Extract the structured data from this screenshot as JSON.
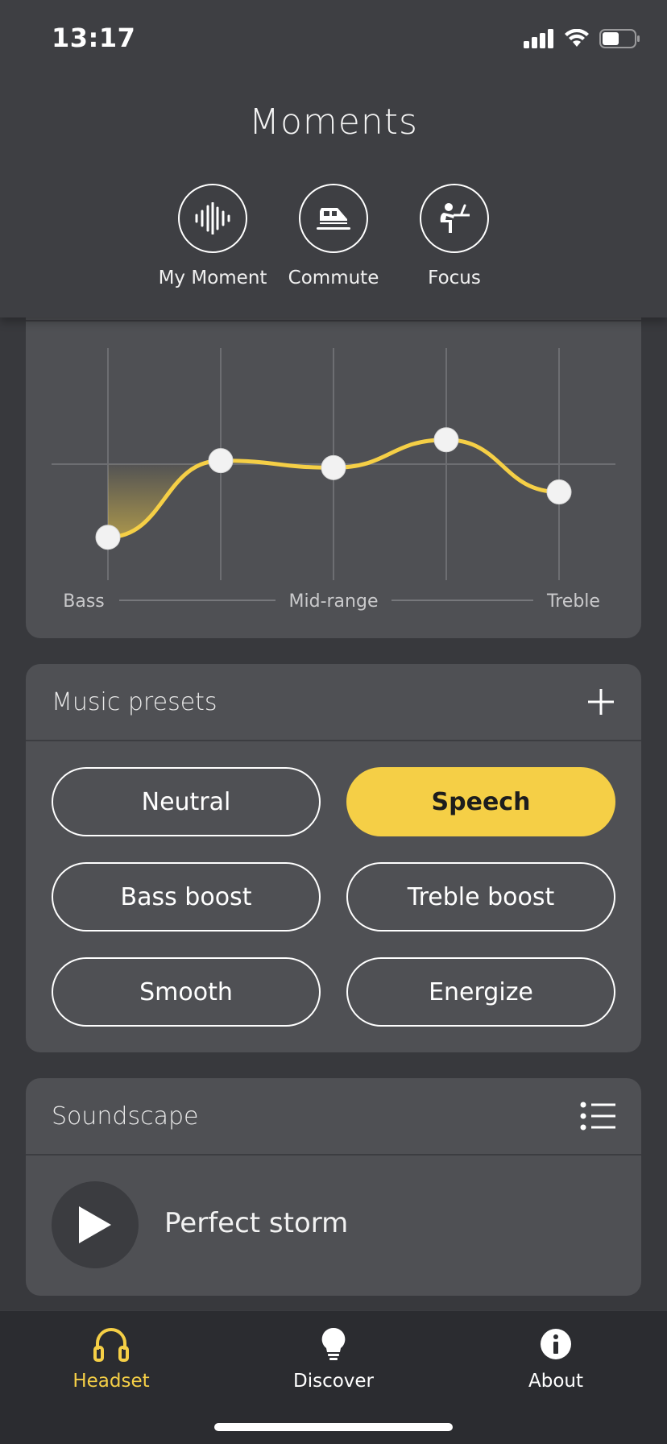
{
  "status": {
    "time": "13:17"
  },
  "header": {
    "title": "Moments",
    "moments": [
      {
        "label": "My Moment",
        "icon": "soundwave-icon"
      },
      {
        "label": "Commute",
        "icon": "train-icon"
      },
      {
        "label": "Focus",
        "icon": "desk-worker-icon"
      }
    ]
  },
  "equalizer": {
    "labels": {
      "bass": "Bass",
      "mid": "Mid-range",
      "treble": "Treble"
    },
    "band_levels": [
      -0.63,
      0.03,
      -0.03,
      0.21,
      -0.24
    ],
    "accent_color": "#f5cf46"
  },
  "presets": {
    "title": "Music presets",
    "add_icon": "plus-icon",
    "items": [
      {
        "label": "Neutral",
        "active": false
      },
      {
        "label": "Speech",
        "active": true
      },
      {
        "label": "Bass boost",
        "active": false
      },
      {
        "label": "Treble boost",
        "active": false
      },
      {
        "label": "Smooth",
        "active": false
      },
      {
        "label": "Energize",
        "active": false
      }
    ]
  },
  "soundscape": {
    "title": "Soundscape",
    "list_icon": "list-icon",
    "track": "Perfect storm",
    "play_icon": "play-icon"
  },
  "tabs": [
    {
      "label": "Headset",
      "icon": "headphones-icon",
      "active": true
    },
    {
      "label": "Discover",
      "icon": "lightbulb-icon",
      "active": false
    },
    {
      "label": "About",
      "icon": "info-icon",
      "active": false
    }
  ],
  "colors": {
    "accent": "#f5cf46",
    "background": "#38393d",
    "card": "#4f5054",
    "tabbar": "#2b2c30"
  }
}
